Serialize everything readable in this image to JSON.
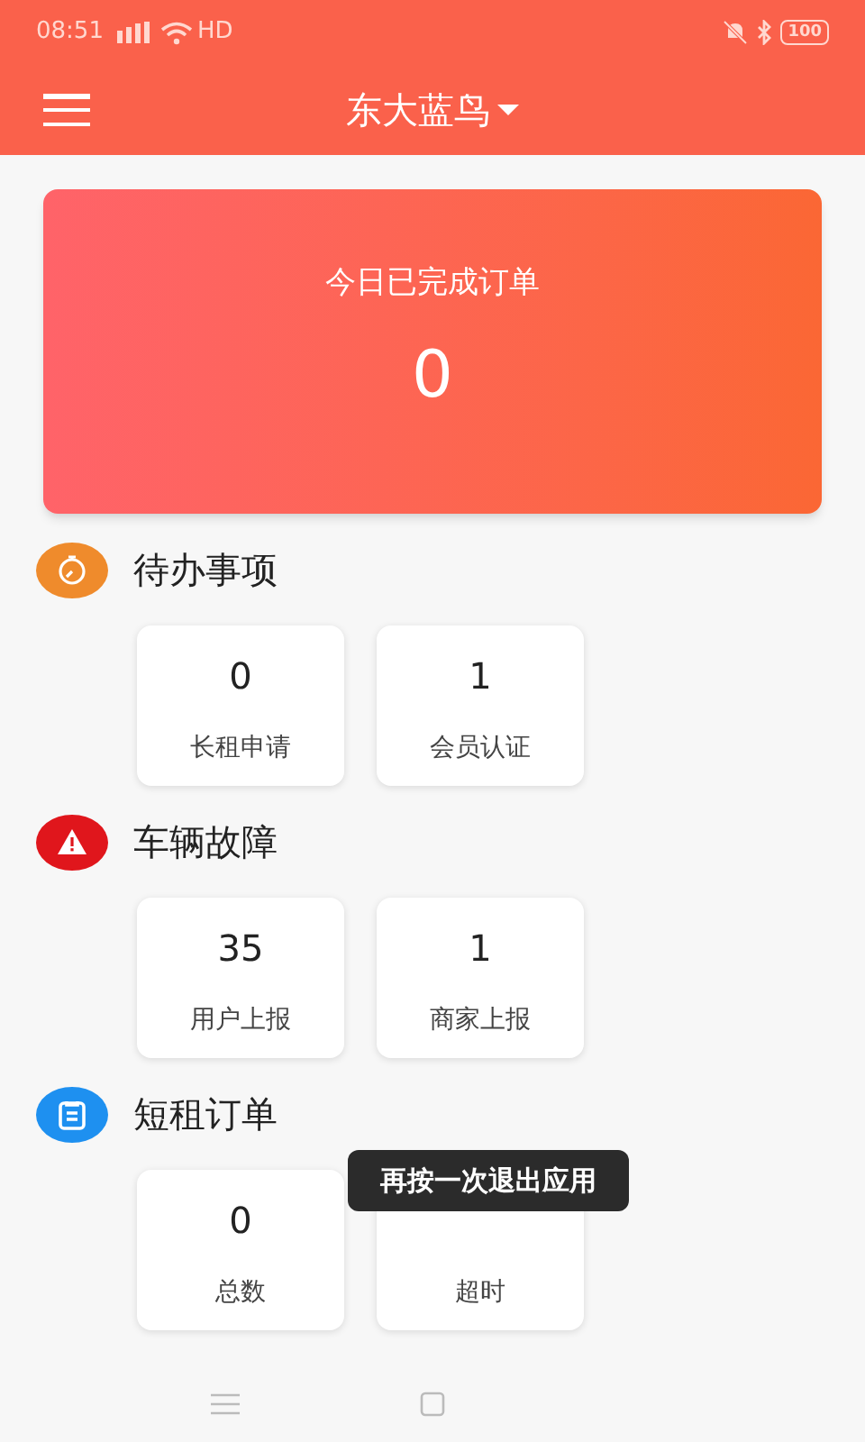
{
  "status_bar": {
    "time": "08:51",
    "network": "HD",
    "battery": "100"
  },
  "app_bar": {
    "title": "东大蓝鸟"
  },
  "summary_card": {
    "label": "今日已完成订单",
    "value": "0"
  },
  "sections": [
    {
      "kind": "todo",
      "title": "待办事项",
      "tiles": [
        {
          "value": "0",
          "label": "长租申请"
        },
        {
          "value": "1",
          "label": "会员认证"
        }
      ]
    },
    {
      "kind": "fault",
      "title": "车辆故障",
      "tiles": [
        {
          "value": "35",
          "label": "用户上报"
        },
        {
          "value": "1",
          "label": "商家上报"
        }
      ]
    },
    {
      "kind": "orders",
      "title": "短租订单",
      "tiles": [
        {
          "value": "0",
          "label": "总数"
        },
        {
          "label": "超时"
        }
      ]
    }
  ],
  "toast": {
    "text": "再按一次退出应用"
  }
}
